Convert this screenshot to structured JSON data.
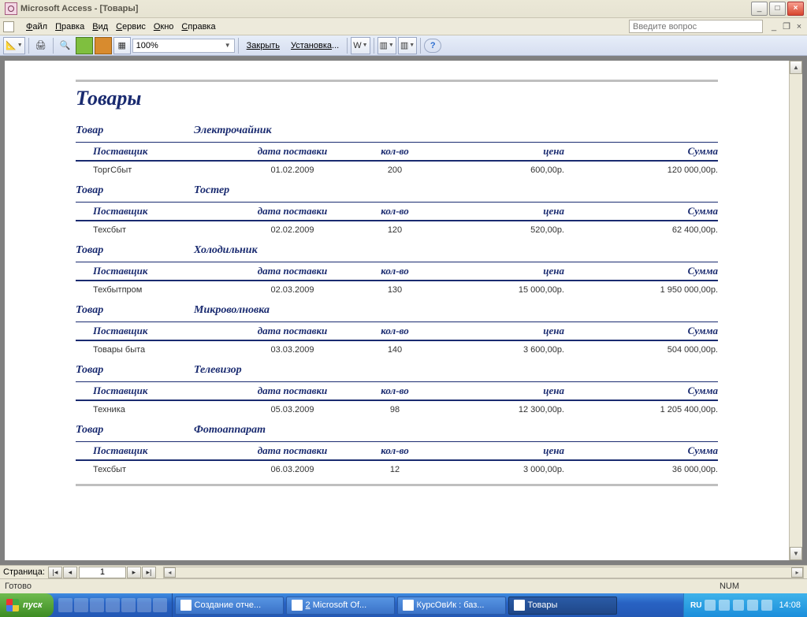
{
  "title": "Microsoft Access - [Товары]",
  "menus": [
    "Файл",
    "Правка",
    "Вид",
    "Сервис",
    "Окно",
    "Справка"
  ],
  "question_placeholder": "Введите вопрос",
  "toolbar": {
    "zoom": "100%",
    "close": "Закрыть",
    "setup": "Установка"
  },
  "report": {
    "title": "Товары",
    "group_label": "Товар",
    "columns": {
      "supplier": "Поставщик",
      "date": "дата поставки",
      "qty": "кол-во",
      "price": "цена",
      "sum": "Сумма"
    },
    "groups": [
      {
        "name": "Электрочайник",
        "rows": [
          {
            "supplier": "ТоргСбыт",
            "date": "01.02.2009",
            "qty": "200",
            "price": "600,00р.",
            "sum": "120 000,00р."
          }
        ]
      },
      {
        "name": "Тостер",
        "rows": [
          {
            "supplier": "Техсбыт",
            "date": "02.02.2009",
            "qty": "120",
            "price": "520,00р.",
            "sum": "62 400,00р."
          }
        ]
      },
      {
        "name": "Холодильник",
        "rows": [
          {
            "supplier": "Техбытпром",
            "date": "02.03.2009",
            "qty": "130",
            "price": "15 000,00р.",
            "sum": "1 950 000,00р."
          }
        ]
      },
      {
        "name": "Микроволновка",
        "rows": [
          {
            "supplier": "Товары быта",
            "date": "03.03.2009",
            "qty": "140",
            "price": "3 600,00р.",
            "sum": "504 000,00р."
          }
        ]
      },
      {
        "name": "Телевизор",
        "rows": [
          {
            "supplier": "Техника",
            "date": "05.03.2009",
            "qty": "98",
            "price": "12 300,00р.",
            "sum": "1 205 400,00р."
          }
        ]
      },
      {
        "name": "Фотоаппарат",
        "rows": [
          {
            "supplier": "Техсбыт",
            "date": "06.03.2009",
            "qty": "12",
            "price": "3 000,00р.",
            "sum": "36 000,00р."
          }
        ]
      }
    ]
  },
  "page_nav": {
    "label": "Страница:",
    "value": "1"
  },
  "status": {
    "ready": "Готово",
    "num": "NUM"
  },
  "taskbar": {
    "start": "пуск",
    "tasks": [
      "Создание отче...",
      "Microsoft Of...",
      "КурсОвИк : баз...",
      "Товары"
    ],
    "lang": "RU",
    "time": "14:08"
  }
}
